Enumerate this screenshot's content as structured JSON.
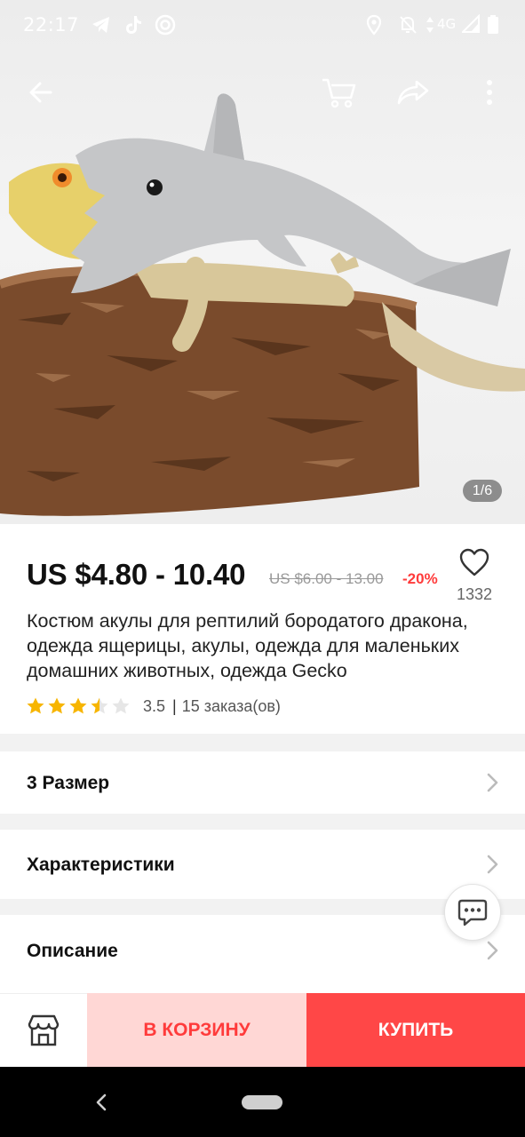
{
  "status_bar": {
    "time": "22:17",
    "network": "4G",
    "icons_left": [
      "telegram-icon",
      "tiktok-icon",
      "app-notification-icon"
    ],
    "icons_right": [
      "location-icon",
      "mute-icon",
      "data-arrows-icon",
      "signal-icon",
      "battery-icon"
    ]
  },
  "top_bar": {
    "icons": [
      "back-arrow-icon",
      "cart-icon",
      "share-icon",
      "more-vert-icon"
    ]
  },
  "gallery": {
    "counter": "1/6"
  },
  "product": {
    "price": "US $4.80 - 10.40",
    "old_price": "US $6.00 - 13.00",
    "discount": "-20%",
    "wishlist_count": "1332",
    "title": "Костюм акулы для рептилий бородатого дракона, одежда ящерицы, акулы, одежда для маленьких домашних животных, одежда Gecko",
    "rating": 3.5,
    "rating_text": "3.5",
    "orders_text": "15 заказа(ов)",
    "star_color": "#f7b500"
  },
  "sections": [
    {
      "label": "3 Размер"
    },
    {
      "label": "Характеристики"
    },
    {
      "label": "Описание"
    }
  ],
  "bottom_bar": {
    "store_icon": "store-icon",
    "add_to_cart": "В КОРЗИНУ",
    "buy": "КУПИТЬ"
  },
  "colors": {
    "accent": "#ff4747",
    "accent_light": "#ffd7d5",
    "discount": "#ff3b3b"
  }
}
